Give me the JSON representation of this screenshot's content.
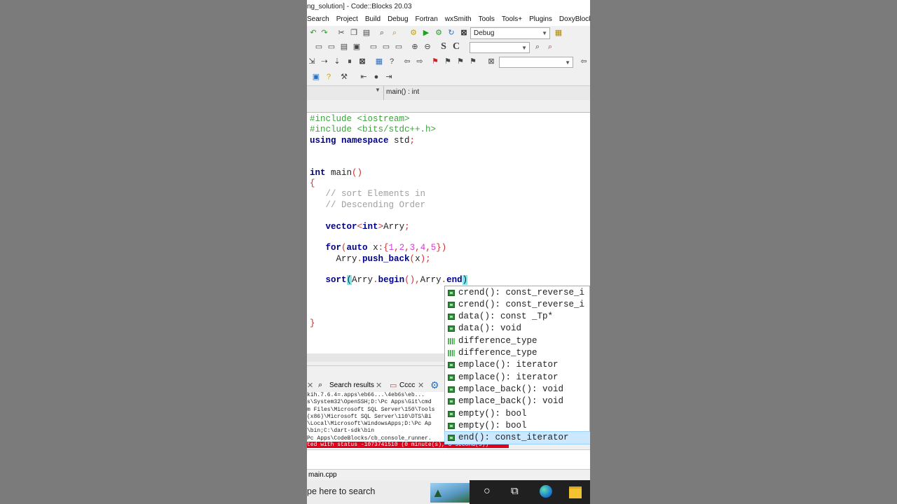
{
  "window": {
    "title": "ng_solution] - Code::Blocks 20.03"
  },
  "menu": [
    "Search",
    "Project",
    "Build",
    "Debug",
    "Fortran",
    "wxSmith",
    "Tools",
    "Tools+",
    "Plugins",
    "DoxyBlocks"
  ],
  "toolbar": {
    "build_target": "Debug",
    "search_combo": "",
    "debug_combo": ""
  },
  "scope": {
    "function": "main() : int"
  },
  "editor": {
    "lines": [
      {
        "parts": [
          [
            "pp",
            "#include <iostream>"
          ]
        ]
      },
      {
        "parts": [
          [
            "pp",
            "#include <bits/stdc++.h>"
          ]
        ]
      },
      {
        "parts": [
          [
            "kw",
            "using namespace "
          ],
          [
            "fn",
            "std"
          ],
          [
            "op",
            ";"
          ]
        ]
      },
      {
        "parts": []
      },
      {
        "parts": []
      },
      {
        "parts": [
          [
            "kw",
            "int "
          ],
          [
            "fn",
            "main"
          ],
          [
            "op",
            "()"
          ]
        ]
      },
      {
        "parts": [
          [
            "op",
            "{"
          ]
        ]
      },
      {
        "parts": [
          [
            "fn",
            "   "
          ],
          [
            "cm",
            "// sort Elements in"
          ]
        ]
      },
      {
        "parts": [
          [
            "fn",
            "   "
          ],
          [
            "cm",
            "// Descending Order"
          ]
        ]
      },
      {
        "parts": []
      },
      {
        "parts": [
          [
            "fn",
            "   "
          ],
          [
            "kw",
            "vector"
          ],
          [
            "op",
            "<"
          ],
          [
            "kw",
            "int"
          ],
          [
            "op",
            ">"
          ],
          [
            "fn",
            "Arry"
          ],
          [
            "op",
            ";"
          ]
        ]
      },
      {
        "parts": []
      },
      {
        "parts": [
          [
            "fn",
            "   "
          ],
          [
            "kw",
            "for"
          ],
          [
            "op",
            "("
          ],
          [
            "kw",
            "auto "
          ],
          [
            "fn",
            "x"
          ],
          [
            "op",
            ":{"
          ],
          [
            "nm",
            "1"
          ],
          [
            "op",
            ","
          ],
          [
            "nm",
            "2"
          ],
          [
            "op",
            ","
          ],
          [
            "nm",
            "3"
          ],
          [
            "op",
            ","
          ],
          [
            "nm",
            "4"
          ],
          [
            "op",
            ","
          ],
          [
            "nm",
            "5"
          ],
          [
            "op",
            "})"
          ]
        ]
      },
      {
        "parts": [
          [
            "fn",
            "     Arry"
          ],
          [
            "op",
            "."
          ],
          [
            "kw",
            "push_back"
          ],
          [
            "op",
            "("
          ],
          [
            "fn",
            "x"
          ],
          [
            "op",
            ");"
          ]
        ]
      },
      {
        "parts": []
      },
      {
        "parts": [
          [
            "fn",
            "   "
          ],
          [
            "kw",
            "sort"
          ],
          [
            "br",
            "("
          ],
          [
            "fn",
            "Arry"
          ],
          [
            "op",
            "."
          ],
          [
            "kw",
            "begin"
          ],
          [
            "op",
            "(),"
          ],
          [
            "fn",
            "Arry"
          ],
          [
            "op",
            "."
          ],
          [
            "kw",
            "end"
          ],
          [
            "br",
            ")"
          ]
        ]
      },
      {
        "parts": []
      },
      {
        "parts": []
      },
      {
        "parts": []
      },
      {
        "parts": [
          [
            "op",
            "}"
          ]
        ]
      }
    ]
  },
  "autocomplete": {
    "items": [
      {
        "icon": "method",
        "text": "crend(): const_reverse_i"
      },
      {
        "icon": "method",
        "text": "crend(): const_reverse_i"
      },
      {
        "icon": "method",
        "text": "data(): const _Tp*"
      },
      {
        "icon": "method",
        "text": "data(): void"
      },
      {
        "icon": "typedef",
        "text": "difference_type"
      },
      {
        "icon": "typedef",
        "text": "difference_type"
      },
      {
        "icon": "method",
        "text": "emplace(): iterator"
      },
      {
        "icon": "method",
        "text": "emplace(): iterator"
      },
      {
        "icon": "method",
        "text": "emplace_back(): void"
      },
      {
        "icon": "method",
        "text": "emplace_back(): void"
      },
      {
        "icon": "method",
        "text": "empty(): bool"
      },
      {
        "icon": "method",
        "text": "empty(): bool"
      },
      {
        "icon": "method",
        "text": "end(): const_iterator",
        "selected": true
      }
    ]
  },
  "log_tabs": [
    "Search results",
    "Cccc"
  ],
  "log": {
    "lines": [
      "kih.7.6.4=.apps\\eb66...\\4eb6s\\eb...",
      "s\\System32\\OpenSSH;D:\\Pc Apps\\Git\\cmd",
      "m Files\\Microsoft SQL Server\\150\\Tools",
      "(x86)\\Microsoft SQL Server\\110\\DTS\\Bi",
      "\\Local\\Microsoft\\WindowsApps;D:\\Pc Ap",
      "\\bin;C:\\dart-sdk\\bin",
      "Pc Apps\\CodeBlocks/cb_console_runner."
    ],
    "error": "ted with status -1073741510 (0 minute(s), 6 second(s))"
  },
  "status": {
    "file": "main.cpp"
  },
  "taskbar": {
    "search_placeholder": "pe here to search"
  }
}
